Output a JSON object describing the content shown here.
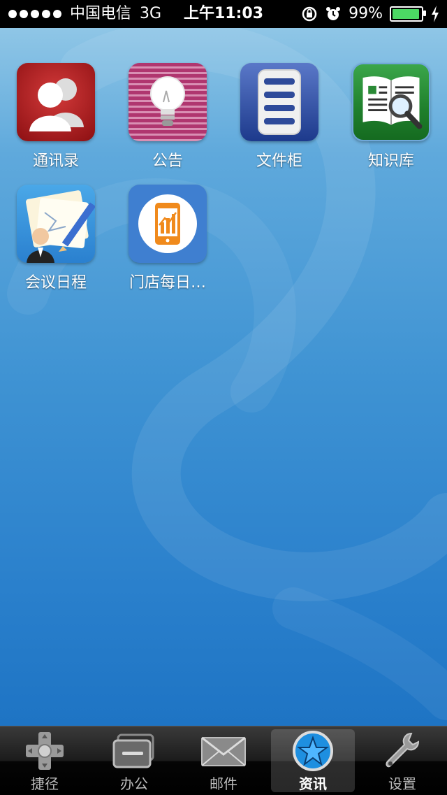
{
  "status_bar": {
    "carrier": "中国电信",
    "network": "3G",
    "time": "上午11:03",
    "battery_percent": "99%",
    "battery_level": 0.99
  },
  "apps": [
    {
      "label": "通讯录",
      "icon": "contacts-icon"
    },
    {
      "label": "公告",
      "icon": "lightbulb-icon"
    },
    {
      "label": "文件柜",
      "icon": "file-cabinet-icon"
    },
    {
      "label": "知识库",
      "icon": "knowledge-book-icon"
    },
    {
      "label": "会议日程",
      "icon": "meeting-schedule-icon"
    },
    {
      "label": "门店每日…",
      "icon": "store-daily-icon"
    }
  ],
  "tab_bar": {
    "active": "资讯",
    "tabs": [
      {
        "label": "捷径",
        "icon": "dpad-icon"
      },
      {
        "label": "办公",
        "icon": "office-icon"
      },
      {
        "label": "邮件",
        "icon": "mail-icon"
      },
      {
        "label": "资讯",
        "icon": "star-icon"
      },
      {
        "label": "设置",
        "icon": "wrench-icon"
      }
    ]
  },
  "colors": {
    "background_top": "#8fc6e6",
    "background_bottom": "#1e74c4",
    "battery_green": "#4cd964",
    "accent_orange": "#f08a1c"
  }
}
